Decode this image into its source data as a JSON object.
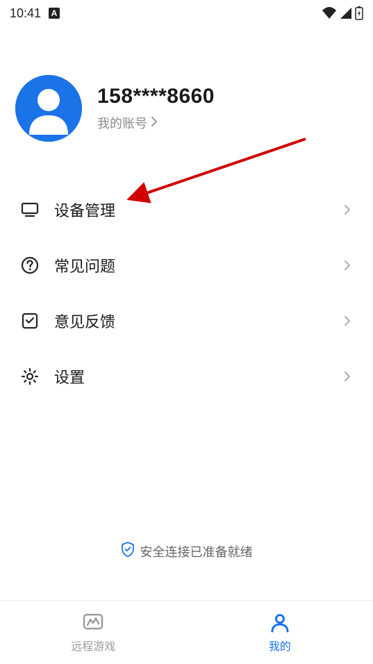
{
  "status_bar": {
    "time": "10:41"
  },
  "profile": {
    "phone": "158****8660",
    "account_label": "我的账号"
  },
  "menu": {
    "items": [
      {
        "label": "设备管理"
      },
      {
        "label": "常见问题"
      },
      {
        "label": "意见反馈"
      },
      {
        "label": "设置"
      }
    ]
  },
  "secure_status": "安全连接已准备就绪",
  "bottom_nav": {
    "items": [
      {
        "label": "远程游戏"
      },
      {
        "label": "我的"
      }
    ]
  },
  "colors": {
    "accent": "#1b73e8",
    "arrow": "#d00000"
  }
}
